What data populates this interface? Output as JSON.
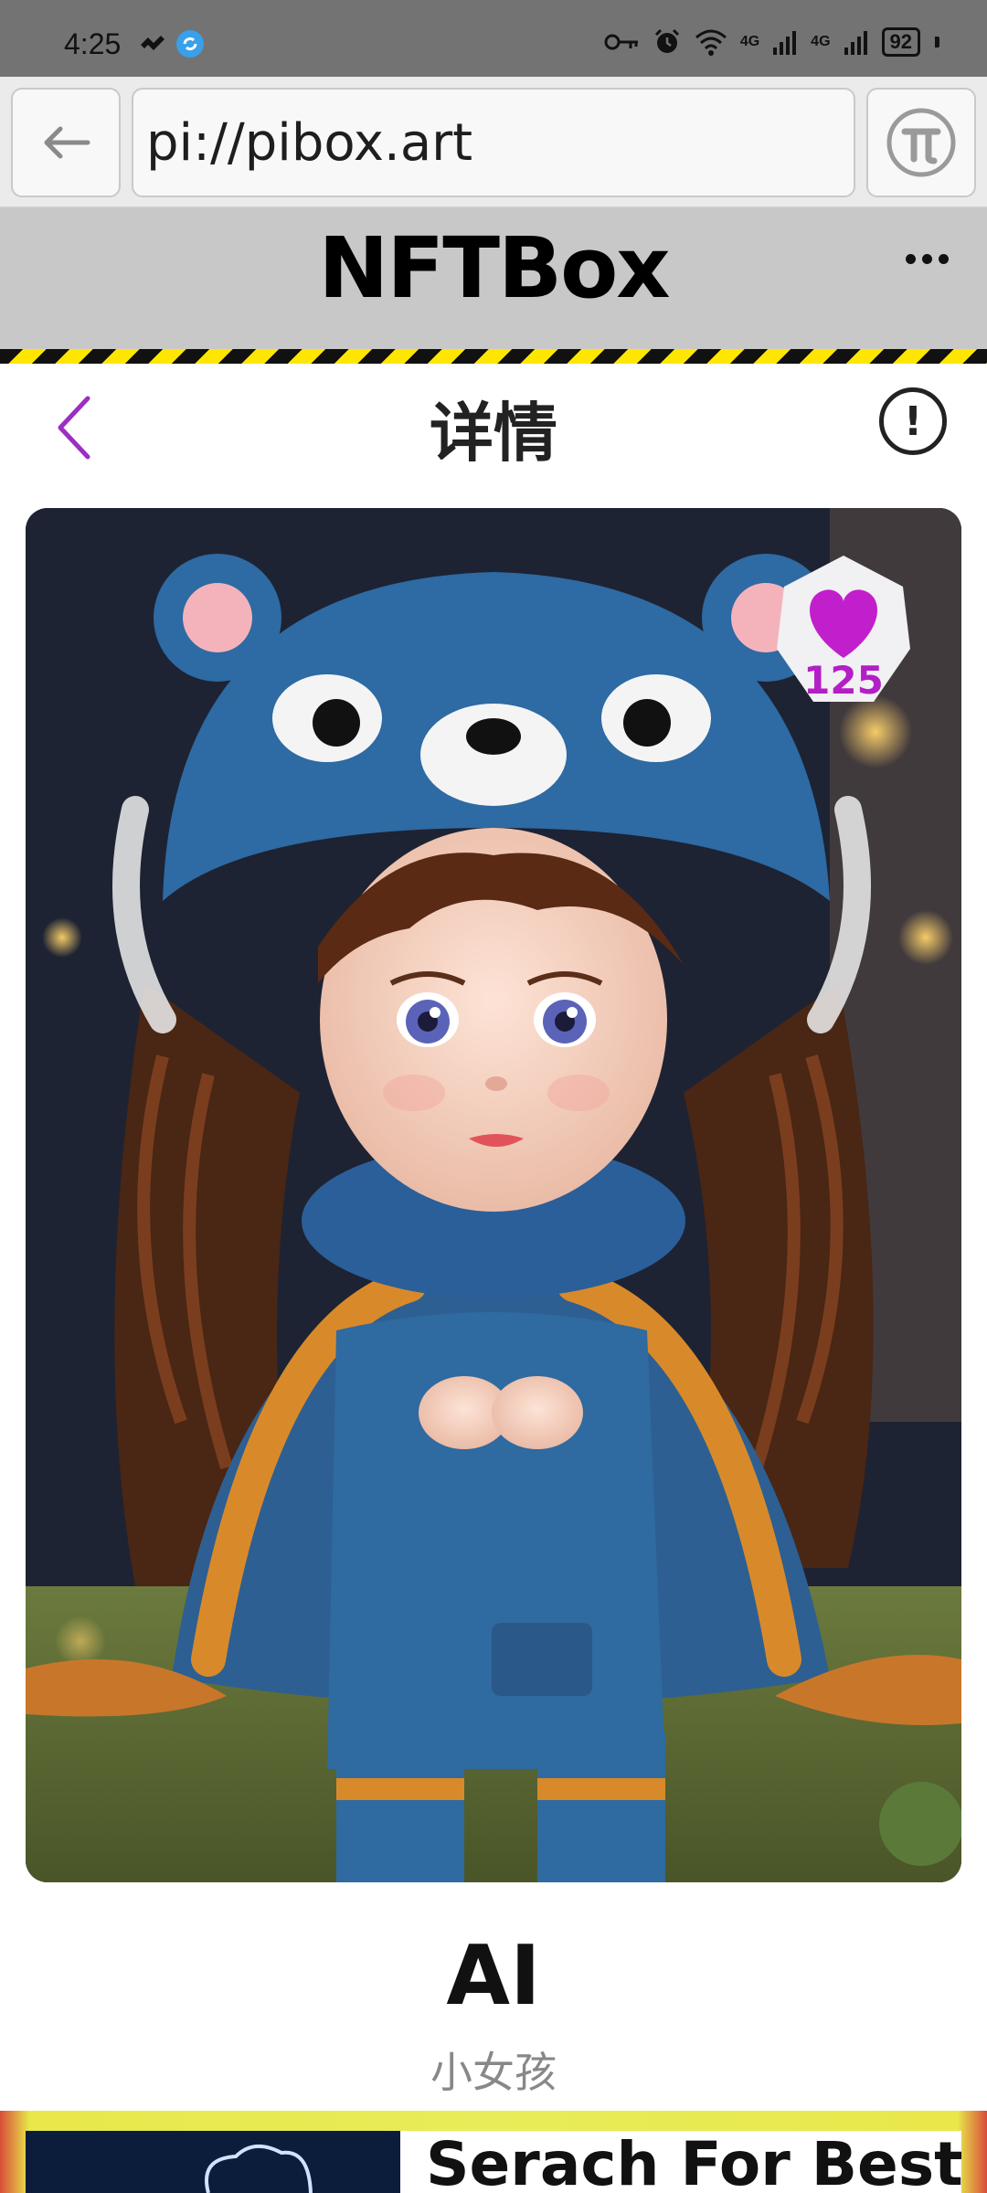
{
  "status_bar": {
    "time": "4:25",
    "network_1": "4G",
    "network_2": "4G",
    "battery": "92"
  },
  "browser": {
    "url": "pi://pibox.art"
  },
  "app": {
    "title": "NFTBox"
  },
  "page": {
    "title": "详情"
  },
  "nft": {
    "likes": "125",
    "name": "AI",
    "description": "小女孩"
  },
  "ad": {
    "text": "Serach For Best"
  },
  "colors": {
    "accent_purple": "#9b2fc4",
    "like_magenta": "#b41ec6",
    "header_gray": "#c8c8c8",
    "hazard_yellow": "#ffe600"
  },
  "icons": {
    "back": "arrow-left-icon",
    "pi": "pi-network-icon",
    "menu": "more-dots-icon",
    "nav_back": "chevron-left-icon",
    "info": "info-circle-icon",
    "like": "heart-icon"
  }
}
